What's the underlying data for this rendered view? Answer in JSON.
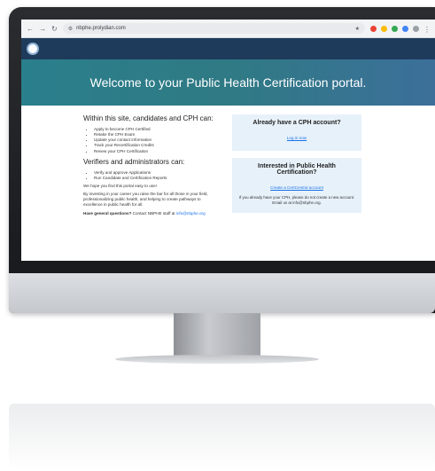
{
  "browser": {
    "url": "nbphe.prolydian.com",
    "ext_colors": [
      "#ea4335",
      "#fbbc05",
      "#34a853",
      "#4285f4",
      "#9aa0a6"
    ]
  },
  "hero": {
    "title": "Welcome to your Public Health Certification portal."
  },
  "left": {
    "heading1": "Within this site, candidates and CPH can:",
    "list1": [
      "Apply to become CPH Certified",
      "Retake the CPH Exam",
      "Update your contact information",
      "Track your Recertification Credits",
      "Renew your CPH Certification"
    ],
    "heading2": "Verifiers and administrators can:",
    "list2": [
      "Verify and approve Applications",
      "Run Candidate and Certification Reports"
    ],
    "hope": "We hope you find this portal easy to use!",
    "investing": "By investing in your career you raise the bar for all those in your field, professionalizing public health, and helping to create pathways to excellence in public health for all.",
    "questions_bold": "Have general questions?",
    "questions_rest": " Contact NBPHE staff at ",
    "questions_email": "info@nbphe.org"
  },
  "right": {
    "card1_title": "Already have a CPH account?",
    "card1_link": "Log in now",
    "card2_title": "Interested in Public Health Certification?",
    "card2_link": "Create a CertCentral account",
    "card2_text": "If you already have your CPH, please do not create a new account. Email us at info@nbphe.org."
  }
}
